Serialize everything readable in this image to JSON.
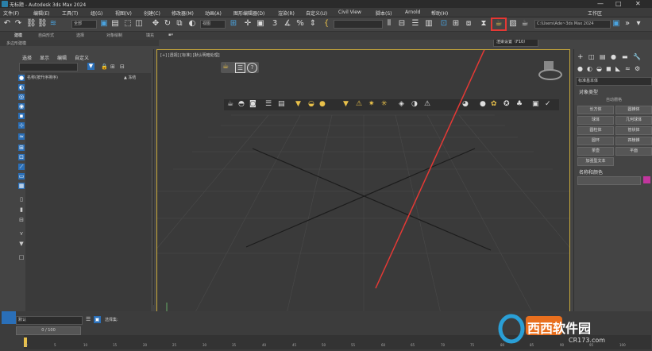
{
  "app": {
    "title": "无标题 - Autodesk 3ds Max 2024",
    "workspace": "工作区",
    "window_controls": [
      "—",
      "□",
      "✕"
    ]
  },
  "menu": [
    "文件(F)",
    "编辑(E)",
    "工具(T)",
    "组(G)",
    "视图(V)",
    "创建(C)",
    "修改器(M)",
    "动画(A)",
    "图形编辑器(D)",
    "渲染(R)",
    "自定义(U)",
    "Civil View",
    "脚本(S)",
    "Arnold",
    "帮助(H)"
  ],
  "toolbar": {
    "selection_filter": "全部",
    "view_dropdown": "视图",
    "path_dropdown": "C:\\Users\\Ade~3ds Max 2024",
    "icons": [
      "undo-icon",
      "redo-icon",
      "link-icon",
      "unlink-icon",
      "bind-icon",
      "select-icon",
      "select-by-name-icon",
      "rect-select-icon",
      "window-crossing-icon",
      "move-icon",
      "rotate-icon",
      "scale-icon",
      "place-icon",
      "mirror-icon",
      "align-icon",
      "snap-icon",
      "angle-snap-icon",
      "percent-snap-icon",
      "spinner-snap-icon",
      "named-sel-icon",
      "mirror2-icon",
      "layer-icon",
      "ribbon-icon",
      "schematic-icon",
      "material-editor-icon",
      "render-setup-icon",
      "rendered-frame-icon",
      "render-icon"
    ],
    "tooltip": "渲染设置（F10）"
  },
  "ribbon": {
    "row1": [
      "建模",
      "自由形式",
      "选择",
      "对象绘制",
      "填充"
    ],
    "row2": "多边形建模"
  },
  "explorer": {
    "tabs": [
      "选择",
      "显示",
      "编辑",
      "自定义"
    ],
    "columns": {
      "name": "名称(按升序排序)",
      "frozen": "▲ 冻结"
    },
    "bottom_layer": "默认",
    "bottom_label": "选择集:"
  },
  "viewport": {
    "label": "[+] [透视] [标准] [默认明暗处理]",
    "floating_toolbar_icons": [
      "teapot-icon",
      "sphere-icon",
      "camera-icon",
      "list-icon",
      "clapper-icon",
      "light-icon",
      "sun-icon",
      "particles-icon",
      "box-icon",
      "environment-icon",
      "render-icon"
    ]
  },
  "command_panel": {
    "category": "标准基本体",
    "rollout_object_type": "对象类型",
    "autogrid": "自动栅格",
    "buttons": [
      "长方体",
      "圆锥体",
      "球体",
      "几何球体",
      "圆柱体",
      "管状体",
      "圆环",
      "四棱锥",
      "茶壶",
      "平面",
      "加强型文本"
    ],
    "rollout_name_color": "名称和颜色",
    "color_swatch": "#c2369e"
  },
  "timeline": {
    "frame_counter": "0 / 100",
    "ticks": [
      "0",
      "5",
      "10",
      "15",
      "20",
      "25",
      "30",
      "35",
      "40",
      "45",
      "50",
      "55",
      "60",
      "65",
      "70",
      "75",
      "80",
      "85",
      "90",
      "95",
      "100"
    ]
  },
  "watermark": {
    "brand": "西西软件园",
    "url": "CR173.com"
  },
  "colors": {
    "accent": "#2a6fb8",
    "highlight": "#e53935",
    "viewport_border": "#c8a83a"
  }
}
